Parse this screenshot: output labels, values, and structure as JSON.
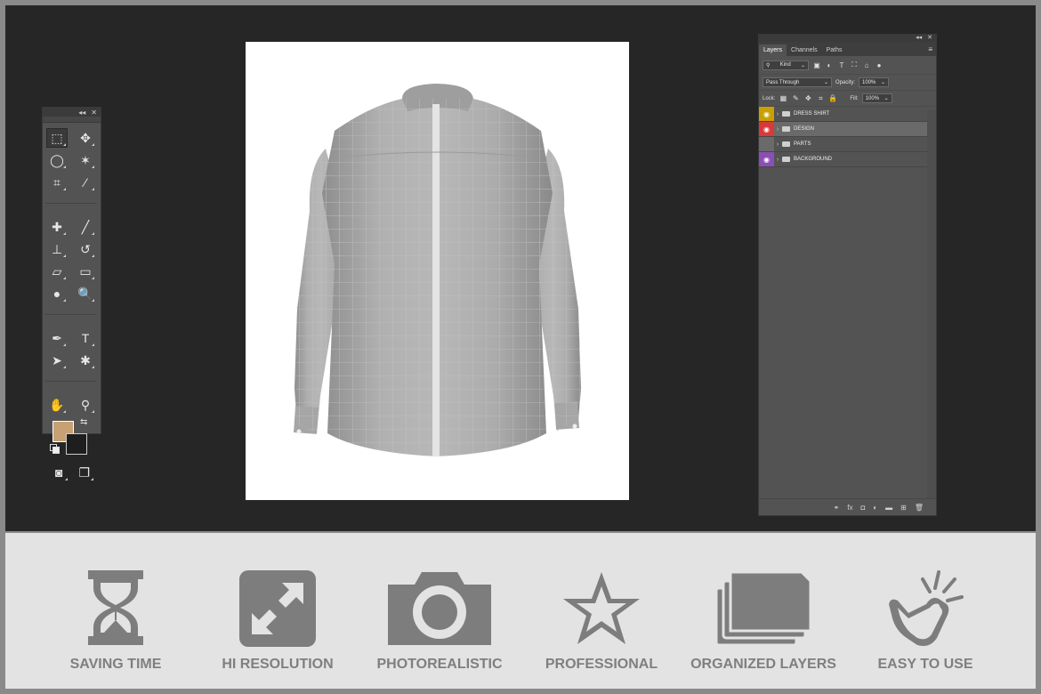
{
  "tools_panel": {
    "collapse_glyph": "◂◂",
    "close_glyph": "✕",
    "tools": [
      {
        "name": "rectangular-marquee-icon",
        "glyph": "⬚"
      },
      {
        "name": "move-icon",
        "glyph": "✥"
      },
      {
        "name": "lasso-icon",
        "glyph": "◯"
      },
      {
        "name": "magic-wand-icon",
        "glyph": "✶"
      },
      {
        "name": "crop-icon",
        "glyph": "⌗"
      },
      {
        "name": "eyedropper-icon",
        "glyph": "⁄"
      },
      {
        "name": "healing-brush-icon",
        "glyph": "✚"
      },
      {
        "name": "brush-icon",
        "glyph": "╱"
      },
      {
        "name": "clone-stamp-icon",
        "glyph": "⊥"
      },
      {
        "name": "history-brush-icon",
        "glyph": "↺"
      },
      {
        "name": "eraser-icon",
        "glyph": "▱"
      },
      {
        "name": "gradient-icon",
        "glyph": "▭"
      },
      {
        "name": "blur-icon",
        "glyph": "●"
      },
      {
        "name": "dodge-icon",
        "glyph": "🔍"
      },
      {
        "name": "pen-icon",
        "glyph": "✒"
      },
      {
        "name": "type-icon",
        "glyph": "T"
      },
      {
        "name": "path-selection-icon",
        "glyph": "➤"
      },
      {
        "name": "custom-shape-icon",
        "glyph": "✱"
      },
      {
        "name": "hand-icon",
        "glyph": "✋"
      },
      {
        "name": "zoom-icon",
        "glyph": "⚲"
      }
    ],
    "foreground_color": "#c7a173",
    "background_color": "#1e1e1e",
    "swap_glyph": "⇆",
    "quick_mask_glyph": "◙",
    "screen_mode_glyph": "❐"
  },
  "canvas": {
    "background": "#ffffff",
    "shirt_color": "#a7a7a7"
  },
  "layers_panel": {
    "collapse_glyph": "◂◂",
    "close_glyph": "✕",
    "tabs": [
      {
        "label": "Layers",
        "active": true
      },
      {
        "label": "Channels",
        "active": false
      },
      {
        "label": "Paths",
        "active": false
      }
    ],
    "menu_glyph": "≡",
    "filter": {
      "label": "Kind",
      "glyph": "⚲"
    },
    "filter_icons": [
      "▣",
      "◐",
      "T",
      "⛶",
      "⌂",
      "●"
    ],
    "blend_mode": "Pass Through",
    "opacity_label": "Opacity:",
    "opacity_value": "100%",
    "lock_label": "Lock:",
    "lock_icons": [
      "▦",
      "✎",
      "✥",
      "⌗",
      "🔒"
    ],
    "fill_label": "Fill:",
    "fill_value": "100%",
    "layers": [
      {
        "name": "DRESS SHIRT",
        "eye_color": "#c9a000",
        "visible": true,
        "selected": false
      },
      {
        "name": "DESIGN",
        "eye_color": "#d83a3a",
        "visible": true,
        "selected": true
      },
      {
        "name": "PARTS",
        "eye_color": "#6a6a6a",
        "visible": false,
        "selected": false
      },
      {
        "name": "BACKGROUND",
        "eye_color": "#8a4fb5",
        "visible": true,
        "selected": false
      }
    ],
    "bottom_icons": [
      {
        "name": "link-icon",
        "glyph": "⚭"
      },
      {
        "name": "fx-icon",
        "glyph": "fx"
      },
      {
        "name": "mask-icon",
        "glyph": "◘"
      },
      {
        "name": "adjustment-icon",
        "glyph": "◐"
      },
      {
        "name": "group-icon",
        "glyph": "▬"
      },
      {
        "name": "new-layer-icon",
        "glyph": "⊞"
      },
      {
        "name": "trash-icon",
        "glyph": "🗑"
      }
    ]
  },
  "features": [
    {
      "label": "SAVING TIME",
      "icon": "hourglass-icon"
    },
    {
      "label": "HI RESOLUTION",
      "icon": "expand-icon"
    },
    {
      "label": "PHOTOREALISTIC",
      "icon": "camera-icon"
    },
    {
      "label": "PROFESSIONAL",
      "icon": "star-icon"
    },
    {
      "label": "ORGANIZED LAYERS",
      "icon": "layers-icon"
    },
    {
      "label": "EASY TO USE",
      "icon": "hand-tap-icon"
    }
  ]
}
